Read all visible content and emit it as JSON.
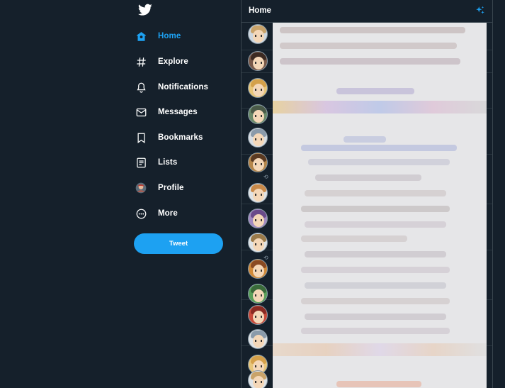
{
  "nav": {
    "logo_icon": "twitter-bird-icon",
    "items": [
      {
        "id": "home",
        "label": "Home",
        "icon": "home-icon",
        "active": true
      },
      {
        "id": "explore",
        "label": "Explore",
        "icon": "hashtag-icon",
        "active": false
      },
      {
        "id": "notifications",
        "label": "Notifications",
        "icon": "bell-icon",
        "active": false
      },
      {
        "id": "messages",
        "label": "Messages",
        "icon": "envelope-icon",
        "active": false
      },
      {
        "id": "bookmarks",
        "label": "Bookmarks",
        "icon": "bookmark-icon",
        "active": false
      },
      {
        "id": "lists",
        "label": "Lists",
        "icon": "list-icon",
        "active": false
      },
      {
        "id": "profile",
        "label": "Profile",
        "icon": "avatar-icon",
        "active": false
      },
      {
        "id": "more",
        "label": "More",
        "icon": "more-circle-icon",
        "active": false
      }
    ],
    "tweet_button_label": "Tweet"
  },
  "main": {
    "title": "Home",
    "sparkle_icon": "sparkle-icon"
  },
  "colors": {
    "background": "#15202b",
    "accent": "#1da1f2",
    "border": "#38444d",
    "text": "#ffffff"
  }
}
